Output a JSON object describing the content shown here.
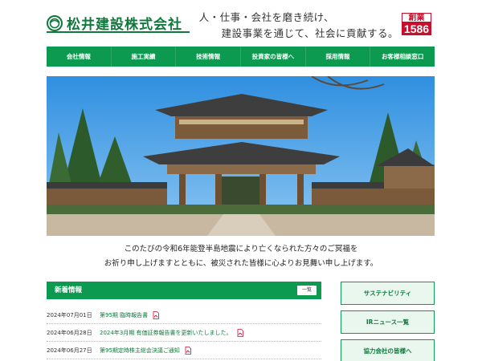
{
  "header": {
    "company_name": "松井建設株式会社",
    "slogan_line1": "人・仕事・会社を磨き続け、",
    "slogan_line2": "建設事業を通じて、社会に貢献する。",
    "badge_label": "創業",
    "badge_year": "1586",
    "brand_color": "#0b9a4f",
    "badge_color": "#c8102e"
  },
  "nav": {
    "items": [
      {
        "label": "会社情報"
      },
      {
        "label": "施工実績"
      },
      {
        "label": "技術情報"
      },
      {
        "label": "投資家の皆様へ"
      },
      {
        "label": "採用情報"
      },
      {
        "label": "お客様相談窓口"
      }
    ]
  },
  "message": {
    "line1": "このたびの令和6年能登半島地震により亡くなられた方々のご冥福を",
    "line2": "お祈り申し上げますとともに、被災された皆様に心よりお見舞い申し上げます。"
  },
  "news": {
    "title": "新着情報",
    "more_label": "一覧",
    "items": [
      {
        "date": "2024年07月01日",
        "text": "第95期 臨時報告書",
        "icon": "pdf-icon"
      },
      {
        "date": "2024年06月28日",
        "text": "2024年3月期 有価証券報告書を更新いたしました。",
        "icon": "pdf-icon"
      },
      {
        "date": "2024年06月27日",
        "text": "第95期定時株主総会決議ご通知",
        "icon": "pdf-icon"
      }
    ]
  },
  "side": {
    "buttons": [
      {
        "label": "サステナビリティ"
      },
      {
        "label": "IRニュース一覧"
      },
      {
        "label": "協力会社の皆様へ"
      }
    ]
  }
}
